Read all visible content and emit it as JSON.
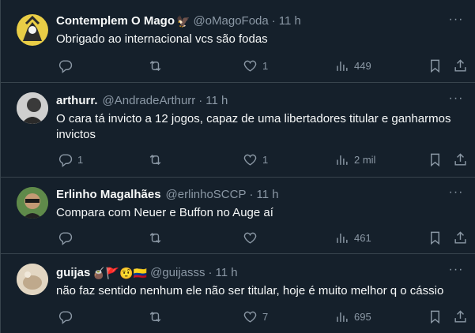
{
  "tweets": [
    {
      "name": "Contemplem O Mago",
      "emojis": "🦅",
      "handle": "@oMagoFoda",
      "dot": "·",
      "time": "11 h",
      "text": "Obrigado ao internacional vcs são fodas",
      "replies": "",
      "retweets": "",
      "likes": "1",
      "views": "449"
    },
    {
      "name": "arthurr.",
      "emojis": "",
      "handle": "@AndradeArthurr",
      "dot": "·",
      "time": "11 h",
      "text": "O cara tá invicto a 12 jogos, capaz de uma libertadores titular e ganharmos invictos",
      "replies": "1",
      "retweets": "",
      "likes": "1",
      "views": "2 mil"
    },
    {
      "name": "Erlinho Magalhães",
      "emojis": "",
      "handle": "@erlinhoSCCP",
      "dot": "·",
      "time": "11 h",
      "text": "Compara com Neuer e Buffon no Auge aí",
      "replies": "",
      "retweets": "",
      "likes": "",
      "views": "461"
    },
    {
      "name": "guijas",
      "emojis": "🧉🚩🤨🇨🇴",
      "handle": "@guijasss",
      "dot": "·",
      "time": "11 h",
      "text": "não faz sentido nenhum ele não ser titular, hoje é muito melhor q o cássio",
      "replies": "",
      "retweets": "",
      "likes": "7",
      "views": "695"
    }
  ],
  "more_glyph": "···",
  "colors": {
    "background": "#15202b",
    "divider": "#38444d",
    "primary_text": "#f7f9f9",
    "secondary_text": "#8b98a5"
  },
  "icons": [
    "reply-icon",
    "retweet-icon",
    "like-icon",
    "views-icon",
    "bookmark-icon",
    "share-icon",
    "more-icon"
  ]
}
